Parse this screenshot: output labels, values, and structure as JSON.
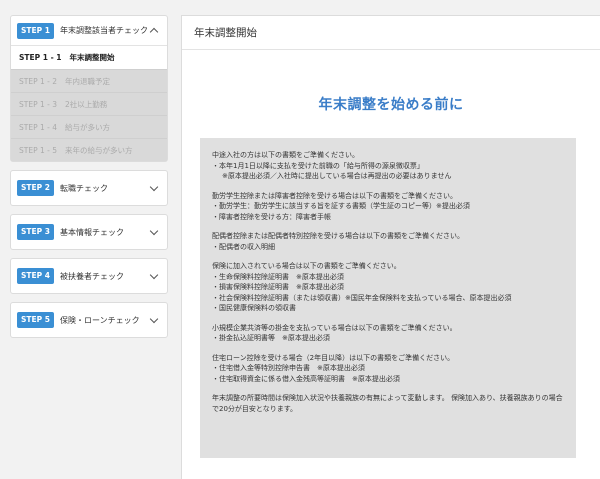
{
  "sidebar": {
    "steps": [
      {
        "badge": "STEP 1",
        "title": "年末調整該当者チェック",
        "expanded": true,
        "items": [
          {
            "code": "STEP 1 - 1",
            "label": "年末調整開始",
            "state": "active"
          },
          {
            "code": "STEP 1 - 2",
            "label": "年内退職予定",
            "state": "disabled"
          },
          {
            "code": "STEP 1 - 3",
            "label": "2社以上勤務",
            "state": "disabled"
          },
          {
            "code": "STEP 1 - 4",
            "label": "給与が多い方",
            "state": "disabled"
          },
          {
            "code": "STEP 1 - 5",
            "label": "来年の給与が多い方",
            "state": "disabled"
          }
        ]
      },
      {
        "badge": "STEP 2",
        "title": "転職チェック",
        "expanded": false
      },
      {
        "badge": "STEP 3",
        "title": "基本情報チェック",
        "expanded": false
      },
      {
        "badge": "STEP 4",
        "title": "被扶養者チェック",
        "expanded": false
      },
      {
        "badge": "STEP 5",
        "title": "保険・ローンチェック",
        "expanded": false
      }
    ]
  },
  "main": {
    "header_title": "年末調整開始",
    "heading": "年末調整を始める前に",
    "paragraphs": [
      {
        "lines": [
          {
            "text": "中途入社の方は以下の書類をご準備ください。",
            "indent": false
          },
          {
            "text": "・本年1月1日以降に支払を受けた前職の「給与所得の源泉徴収票」",
            "indent": false
          },
          {
            "text": "※原本提出必須／入社時に提出している場合は再提出の必要はありません",
            "indent": true
          }
        ]
      },
      {
        "lines": [
          {
            "text": "勤労学生控除または障害者控除を受ける場合は以下の書類をご準備ください。",
            "indent": false
          },
          {
            "text": "・勤労学生：勤労学生に該当する旨を証する書類（学生証のコピー等）※提出必須",
            "indent": false
          },
          {
            "text": "・障害者控除を受ける方：障害者手帳",
            "indent": false
          }
        ]
      },
      {
        "lines": [
          {
            "text": "配偶者控除または配偶者特別控除を受ける場合は以下の書類をご準備ください。",
            "indent": false
          },
          {
            "text": "・配偶者の収入明細",
            "indent": false
          }
        ]
      },
      {
        "lines": [
          {
            "text": "保険に加入されている場合は以下の書類をご準備ください。",
            "indent": false
          },
          {
            "text": "・生命保険料控除証明書　※原本提出必須",
            "indent": false
          },
          {
            "text": "・損害保険料控除証明書　※原本提出必須",
            "indent": false
          },
          {
            "text": "・社会保険料控除証明書（または領収書）※国民年金保険料を支払っている場合、原本提出必須",
            "indent": false
          },
          {
            "text": "・国民健康保険料の領収書",
            "indent": false
          }
        ]
      },
      {
        "lines": [
          {
            "text": "小規模企業共済等の掛金を支払っている場合は以下の書類をご準備ください。",
            "indent": false
          },
          {
            "text": "・掛金払込証明書等　※原本提出必須",
            "indent": false
          }
        ]
      },
      {
        "lines": [
          {
            "text": "住宅ローン控除を受ける場合（2年目以降）は以下の書類をご準備ください。",
            "indent": false
          },
          {
            "text": "・住宅借入金等特別控除申告書　※原本提出必須",
            "indent": false
          },
          {
            "text": "・住宅取得資金に係る借入金残高等証明書　※原本提出必須",
            "indent": false
          }
        ]
      },
      {
        "wrap": true,
        "lines": [
          {
            "text": "年末調整の所要時間は保険加入状況や扶養親族の有無によって変動します。 保険加入あり、扶養親族ありの場合で20分が目安となります。",
            "indent": false
          }
        ]
      }
    ]
  }
}
